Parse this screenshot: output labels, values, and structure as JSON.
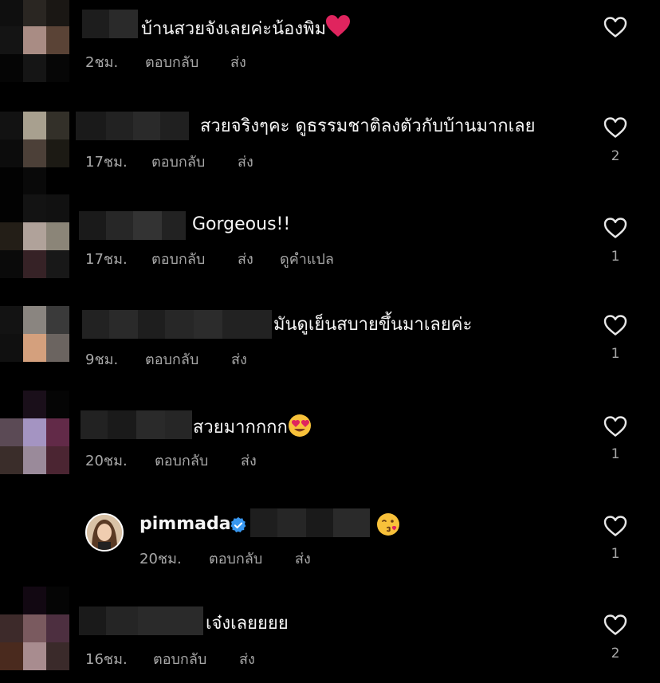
{
  "comments": [
    {
      "text": "บ้านสวยจังเลยค่ะน้องพิม",
      "time": "2ชม.",
      "reply": "ตอบกลับ",
      "send": "ส่ง",
      "likes": ""
    },
    {
      "text": "สวยจริงๆคะ ดูธรรมชาติลงตัวกับบ้านมากเลย",
      "time": "17ชม.",
      "reply": "ตอบกลับ",
      "send": "ส่ง",
      "likes": "2"
    },
    {
      "text": "Gorgeous!!",
      "time": "17ชม.",
      "reply": "ตอบกลับ",
      "send": "ส่ง",
      "translate": "ดูคำแปล",
      "likes": "1"
    },
    {
      "text": "มันดูเย็นสบายขึ้นมาเลยค่ะ",
      "time": "9ชม.",
      "reply": "ตอบกลับ",
      "send": "ส่ง",
      "likes": "1"
    },
    {
      "text": "สวยมากกกก",
      "time": "20ชม.",
      "reply": "ตอบกลับ",
      "send": "ส่ง",
      "likes": "1"
    },
    {
      "username": "pimmada",
      "time": "20ชม.",
      "reply": "ตอบกลับ",
      "send": "ส่ง",
      "likes": "1"
    },
    {
      "text": "เจ๋งเลยยยย",
      "time": "16ชม.",
      "reply": "ตอบกลับ",
      "send": "ส่ง",
      "likes": "2"
    }
  ],
  "icons": {
    "like": "heart-outline-icon",
    "verified": "verified-badge-icon"
  },
  "colors": {
    "background": "#000000",
    "meta": "#a8a8a8",
    "verified": "#3897f0",
    "heart_emoji": "#e0245e"
  }
}
